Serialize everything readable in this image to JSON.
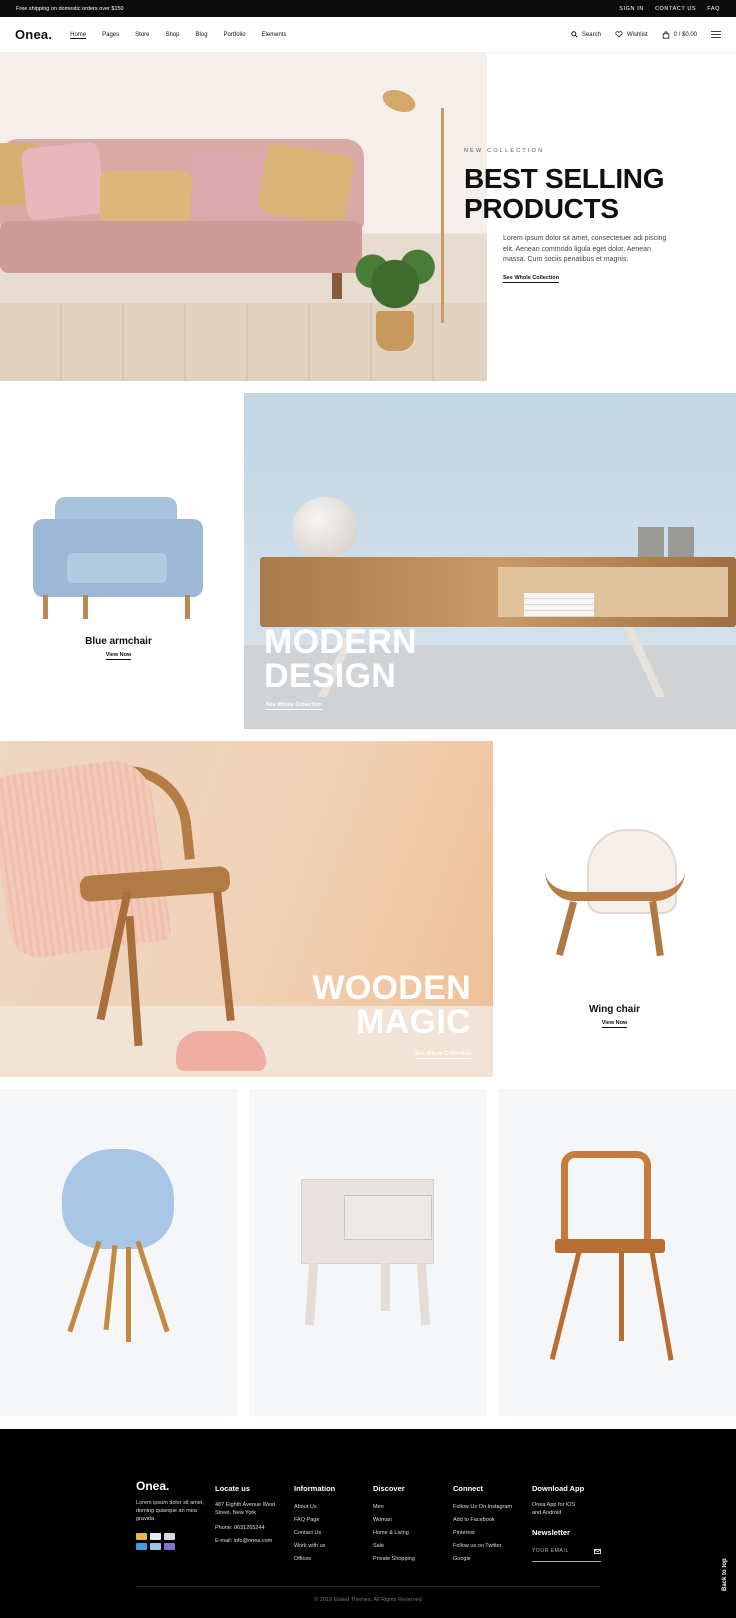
{
  "topbar": {
    "shipping": "Free shipping on domestic orders over $150",
    "links": [
      "SIGN IN",
      "CONTACT US",
      "FAQ"
    ]
  },
  "nav": {
    "logo": "Onea.",
    "menu": [
      "Home",
      "Pages",
      "Store",
      "Shop",
      "Blog",
      "Portfolio",
      "Elements"
    ],
    "active": "Home",
    "search": "Search",
    "wishlist": "Wishlist",
    "cart": "0 / $0.00"
  },
  "hero": {
    "eyebrow": "NEW COLLECTION",
    "title_line1": "BEST SELLING",
    "title_line2": "PRODUCTS",
    "description": "Lorem ipsum dolor sit amet, consectetuer adi piscing elit. Aenean commodo ligula eget dolor. Aenean massa. Cum sociis penatibus et magnis.",
    "link": "See Whole Collection"
  },
  "armchair": {
    "name": "Blue armchair",
    "link": "View Now"
  },
  "modern": {
    "title_line1": "MODERN",
    "title_line2": "DESIGN",
    "link": "See Whole Collection"
  },
  "wooden": {
    "title_line1": "WOODEN",
    "title_line2": "MAGIC",
    "link": "See Whole Collection"
  },
  "wing": {
    "name": "Wing chair",
    "link": "View Now"
  },
  "footer": {
    "logo": "Onea.",
    "about": "Lorem ipsum dolor sit amet, doming quaeque an mea gravida",
    "locate": {
      "heading": "Locate us",
      "address": "487 Eighth Avenue West Street, New York",
      "phone": "Phone: 0631265244",
      "email": "E-mail: info@onea.com"
    },
    "information": {
      "heading": "Information",
      "items": [
        "About Us",
        "FAQ Page",
        "Contact Us",
        "Work with us",
        "Offices"
      ]
    },
    "discover": {
      "heading": "Discover",
      "items": [
        "Men",
        "Woman",
        "Home & Living",
        "Sale",
        "Private Shopping"
      ]
    },
    "connect": {
      "heading": "Connect",
      "items": [
        "Follow Us On Instagram",
        "Add to Facebook",
        "Pinterest",
        "Follow us on Twitter",
        "Google"
      ]
    },
    "app": {
      "heading": "Download App",
      "text": "Onea App for iOS and Android"
    },
    "newsletter": {
      "heading": "Newsletter",
      "placeholder": "YOUR EMAIL"
    },
    "copyright": "© 2018 Elated Themes. All Rights Reserved",
    "back_to_top": "Back to top"
  },
  "colors": {
    "accent_dark": "#000000",
    "card_bg": "#f4f6f7"
  }
}
